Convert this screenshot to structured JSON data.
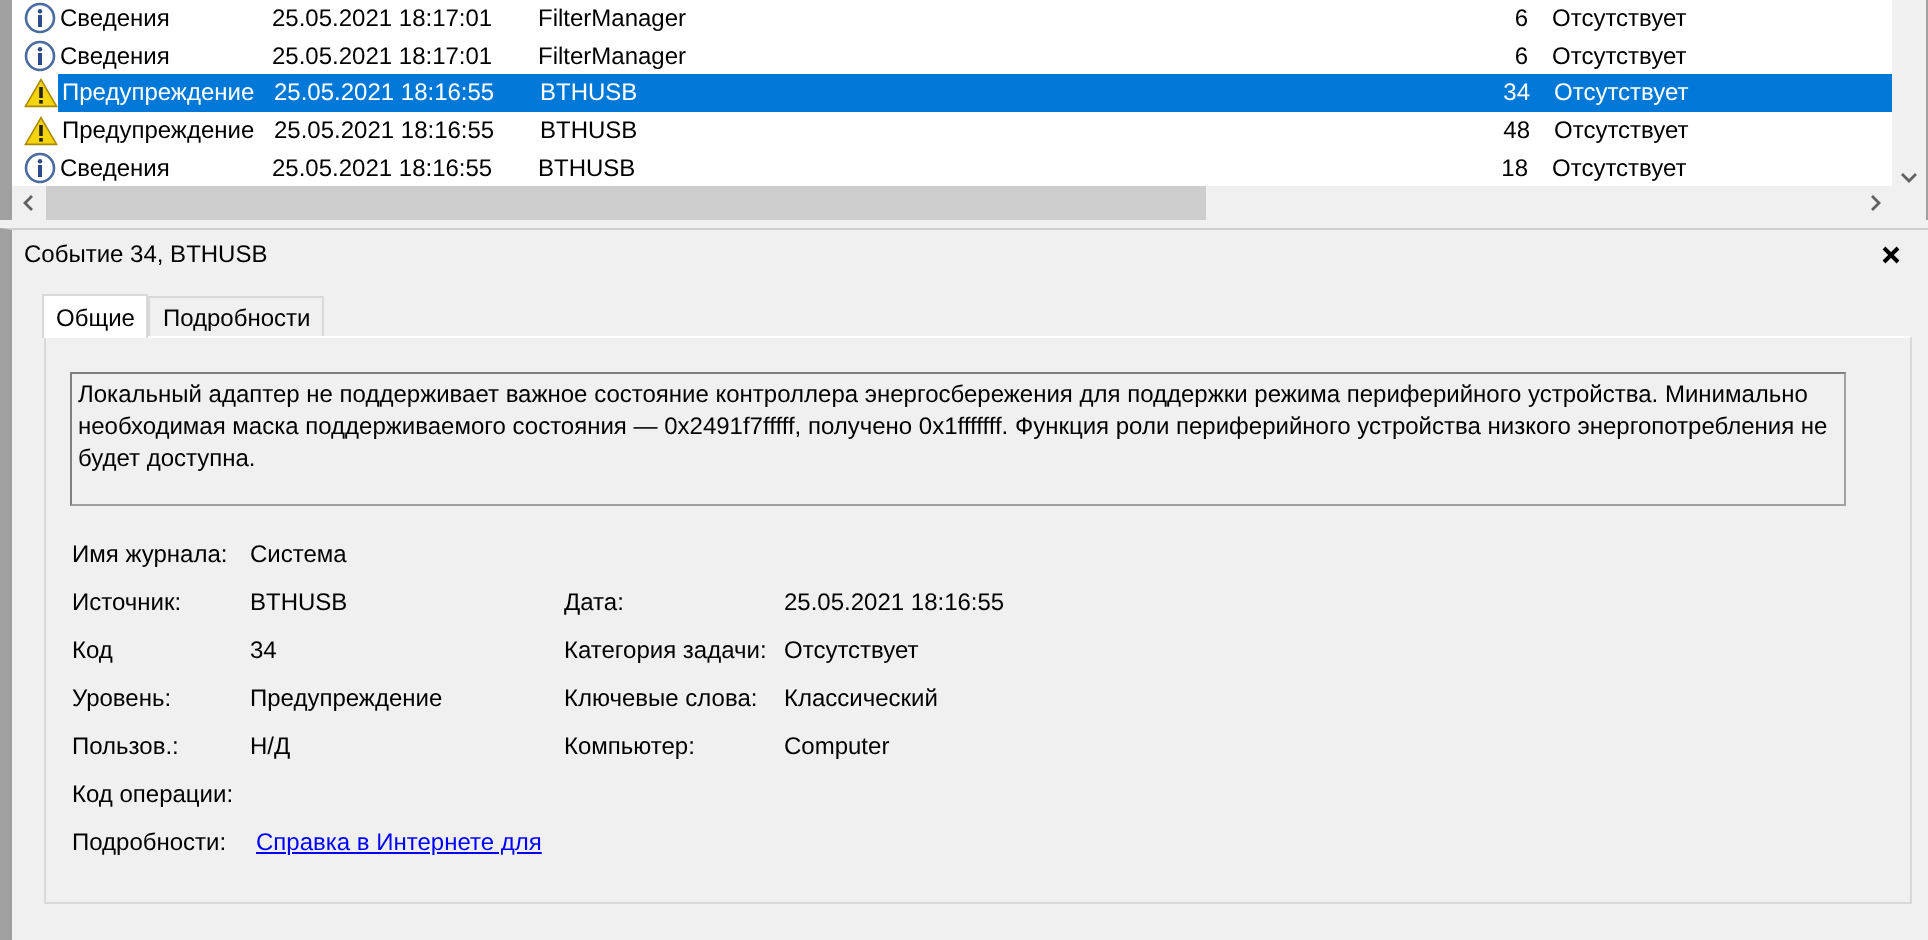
{
  "event_list": {
    "rows": [
      {
        "kind": "info",
        "level": "Сведения",
        "date": "25.05.2021 18:17:01",
        "source": "FilterManager",
        "code": "6",
        "category": "Отсутствует",
        "selected": false
      },
      {
        "kind": "info",
        "level": "Сведения",
        "date": "25.05.2021 18:17:01",
        "source": "FilterManager",
        "code": "6",
        "category": "Отсутствует",
        "selected": false
      },
      {
        "kind": "warning",
        "level": "Предупреждение",
        "date": "25.05.2021 18:16:55",
        "source": "BTHUSB",
        "code": "34",
        "category": "Отсутствует",
        "selected": true
      },
      {
        "kind": "warning",
        "level": "Предупреждение",
        "date": "25.05.2021 18:16:55",
        "source": "BTHUSB",
        "code": "48",
        "category": "Отсутствует",
        "selected": false
      },
      {
        "kind": "info",
        "level": "Сведения",
        "date": "25.05.2021 18:16:55",
        "source": "BTHUSB",
        "code": "18",
        "category": "Отсутствует",
        "selected": false
      }
    ]
  },
  "event_panel": {
    "title": "Событие 34, BTHUSB",
    "tabs": [
      {
        "label": "Общие",
        "selected": true
      },
      {
        "label": "Подробности",
        "selected": false
      }
    ],
    "message": "Локальный адаптер не поддерживает важное состояние контроллера энергосбережения для поддержки режима периферийного устройства. Минимально необходимая маска поддерживаемого состояния — 0x2491f7fffff, получено 0x1fffffff. Функция роли периферийного устройства низкого энергопотребления не будет доступна.",
    "fields": [
      {
        "left": {
          "label": "Имя журнала:",
          "value": "Система"
        }
      },
      {
        "left": {
          "label": "Источник:",
          "value": "BTHUSB"
        },
        "right": {
          "label": "Дата:",
          "value": "25.05.2021 18:16:55"
        }
      },
      {
        "left": {
          "label": "Код",
          "value": "34"
        },
        "right": {
          "label": "Категория задачи:",
          "value": "Отсутствует"
        }
      },
      {
        "left": {
          "label": "Уровень:",
          "value": "Предупреждение"
        },
        "right": {
          "label": "Ключевые слова:",
          "value": "Классический"
        }
      },
      {
        "left": {
          "label": "Пользов.:",
          "value": "Н/Д"
        },
        "right": {
          "label": "Компьютер:",
          "value": "Computer"
        }
      },
      {
        "left": {
          "label": "Код операции:"
        }
      },
      {
        "left": {
          "label": "Подробности:",
          "value": "Справка в Интернете для",
          "kind": "link"
        }
      }
    ]
  }
}
